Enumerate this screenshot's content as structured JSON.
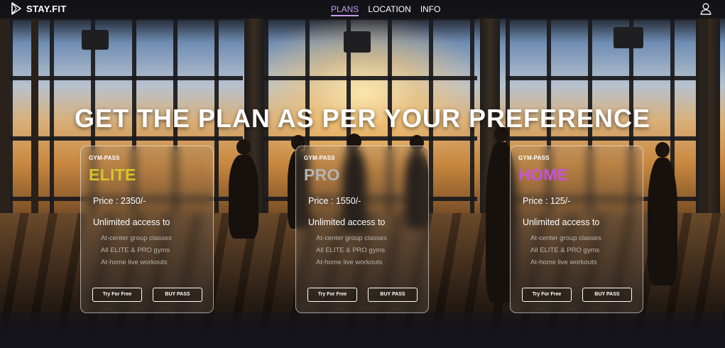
{
  "brand": {
    "name": "STAY.FIT",
    "accent": "#c79bea"
  },
  "nav": {
    "links": [
      {
        "label": "PLANS",
        "active": true
      },
      {
        "label": "LOCATION",
        "active": false
      },
      {
        "label": "INFO",
        "active": false
      }
    ],
    "user_icon": "user-icon"
  },
  "hero": {
    "title": "GET THE PLAN AS PER YOUR PREFERENCE"
  },
  "plans": [
    {
      "pass_label": "GYM-PASS",
      "name": "ELITE",
      "name_color": "#d6c52a",
      "price": "Price : 2350/-",
      "access_label": "Unlimited access to",
      "features": [
        "At-center group classes",
        "All ELITE & PRO gyms",
        "At-home live workouts"
      ],
      "try_label": "Try For Free",
      "buy_label": "BUY PASS"
    },
    {
      "pass_label": "GYM-PASS",
      "name": "PRO",
      "name_color": "#b4b4b4",
      "price": "Price : 1550/-",
      "access_label": "Unlimited access to",
      "features": [
        "At-center group classes",
        "All ELITE & PRO gyms",
        "At-home live workouts"
      ],
      "try_label": "Try For Free",
      "buy_label": "BUY PASS"
    },
    {
      "pass_label": "GYM-PASS",
      "name": "HOME",
      "name_color": "#c653d8",
      "price": "Price : 125/-",
      "access_label": "Unlimited access to",
      "features": [
        "At-center group classes",
        "All ELITE & PRO gyms",
        "At-home live workouts"
      ],
      "try_label": "Try For Free",
      "buy_label": "BUY PASS"
    }
  ]
}
